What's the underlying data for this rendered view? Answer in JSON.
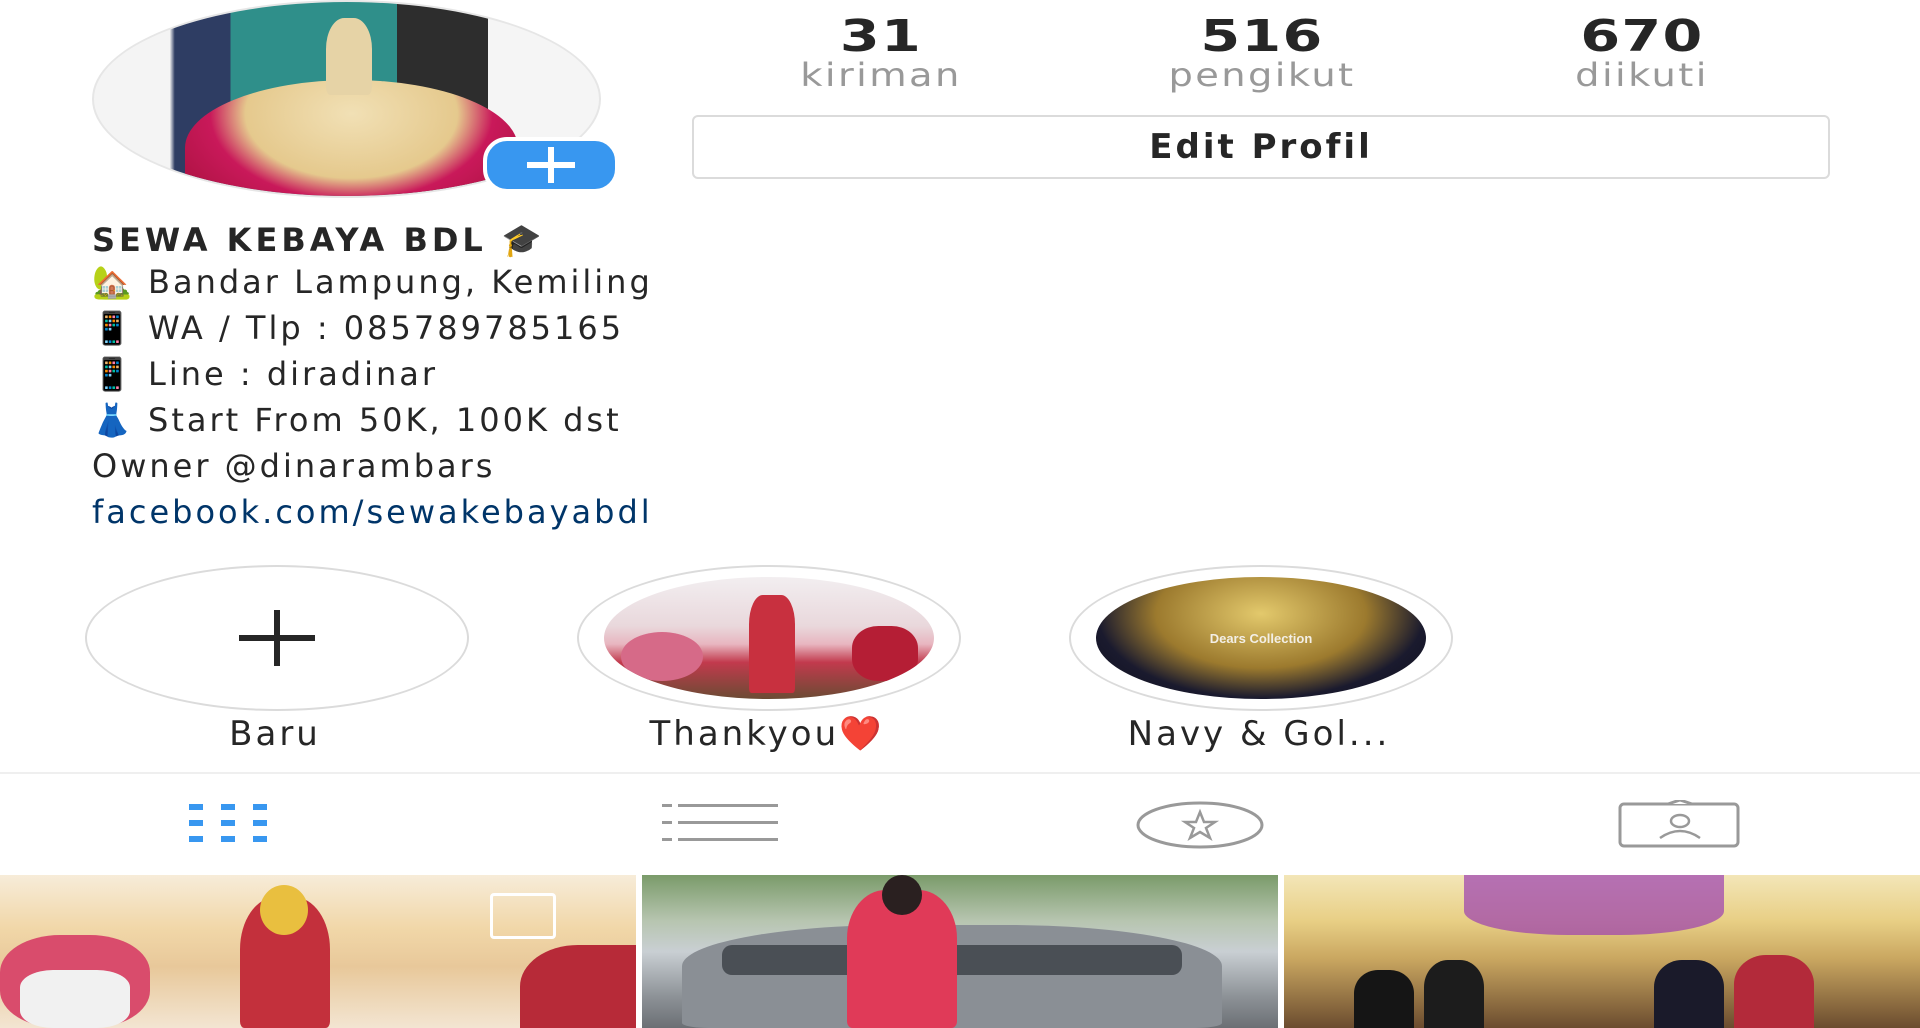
{
  "profile": {
    "stats": [
      {
        "value": "31",
        "label": "kiriman"
      },
      {
        "value": "516",
        "label": "pengikut"
      },
      {
        "value": "670",
        "label": "diikuti"
      }
    ],
    "edit_button": "Edit Profil",
    "add_story_icon": "plus-icon",
    "accent_color": "#3897f0"
  },
  "bio": {
    "name": "SEWA KEBAYA BDL 🎓",
    "lines": [
      "🏡  Bandar Lampung, Kemiling",
      "📱 WA / Tlp : 085789785165",
      "📱 Line : diradinar",
      "👗 Start From 50K, 100K dst",
      "Owner @dinarambars"
    ],
    "link": "facebook.com/sewakebayabdl",
    "link_color": "#003569"
  },
  "highlights": [
    {
      "label": "Baru"
    },
    {
      "label": "Thankyou❤️"
    },
    {
      "label": "Navy & Gol...",
      "cover_text": "Dears Collection"
    }
  ],
  "tabs": {
    "icons": [
      "grid-icon",
      "list-icon",
      "saved-icon",
      "tagged-icon"
    ],
    "active_color": "#3897f0",
    "inactive_color": "#999999"
  }
}
